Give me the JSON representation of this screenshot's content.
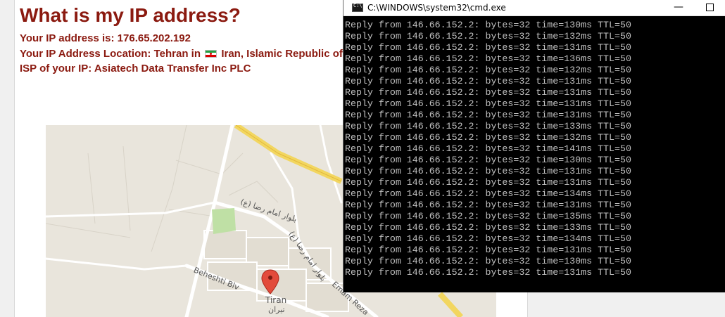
{
  "page": {
    "heading": "What is my IP address?",
    "ip_line": "Your IP address is: 176.65.202.192",
    "location_prefix": "Your IP Address Location: Tehran in",
    "location_country": "Iran, Islamic Republic of",
    "isp_line": "ISP of your IP: Asiatech Data Transfer Inc PLC"
  },
  "map": {
    "labels": {
      "street1": "بلوار امام رضا (ع)",
      "street2": "بلوار امام رضا (ع)",
      "beheshti": "Beheshti Blv",
      "emam_reza": "Emam Reza",
      "tiran": "Tiran",
      "tiran_fa": "تیران"
    },
    "pin_color": "#e24b3b"
  },
  "cmd": {
    "title": "C:\\WINDOWS\\system32\\cmd.exe",
    "minimize_label": "—",
    "lines": [
      "Reply from 146.66.152.2: bytes=32 time=130ms TTL=50",
      "Reply from 146.66.152.2: bytes=32 time=132ms TTL=50",
      "Reply from 146.66.152.2: bytes=32 time=131ms TTL=50",
      "Reply from 146.66.152.2: bytes=32 time=136ms TTL=50",
      "Reply from 146.66.152.2: bytes=32 time=132ms TTL=50",
      "Reply from 146.66.152.2: bytes=32 time=131ms TTL=50",
      "Reply from 146.66.152.2: bytes=32 time=131ms TTL=50",
      "Reply from 146.66.152.2: bytes=32 time=131ms TTL=50",
      "Reply from 146.66.152.2: bytes=32 time=131ms TTL=50",
      "Reply from 146.66.152.2: bytes=32 time=133ms TTL=50",
      "Reply from 146.66.152.2: bytes=32 time=132ms TTL=50",
      "Reply from 146.66.152.2: bytes=32 time=141ms TTL=50",
      "Reply from 146.66.152.2: bytes=32 time=130ms TTL=50",
      "Reply from 146.66.152.2: bytes=32 time=131ms TTL=50",
      "Reply from 146.66.152.2: bytes=32 time=131ms TTL=50",
      "Reply from 146.66.152.2: bytes=32 time=134ms TTL=50",
      "Reply from 146.66.152.2: bytes=32 time=131ms TTL=50",
      "Reply from 146.66.152.2: bytes=32 time=135ms TTL=50",
      "Reply from 146.66.152.2: bytes=32 time=133ms TTL=50",
      "Reply from 146.66.152.2: bytes=32 time=134ms TTL=50",
      "Reply from 146.66.152.2: bytes=32 time=131ms TTL=50",
      "Reply from 146.66.152.2: bytes=32 time=130ms TTL=50",
      "Reply from 146.66.152.2: bytes=32 time=131ms TTL=50"
    ]
  }
}
